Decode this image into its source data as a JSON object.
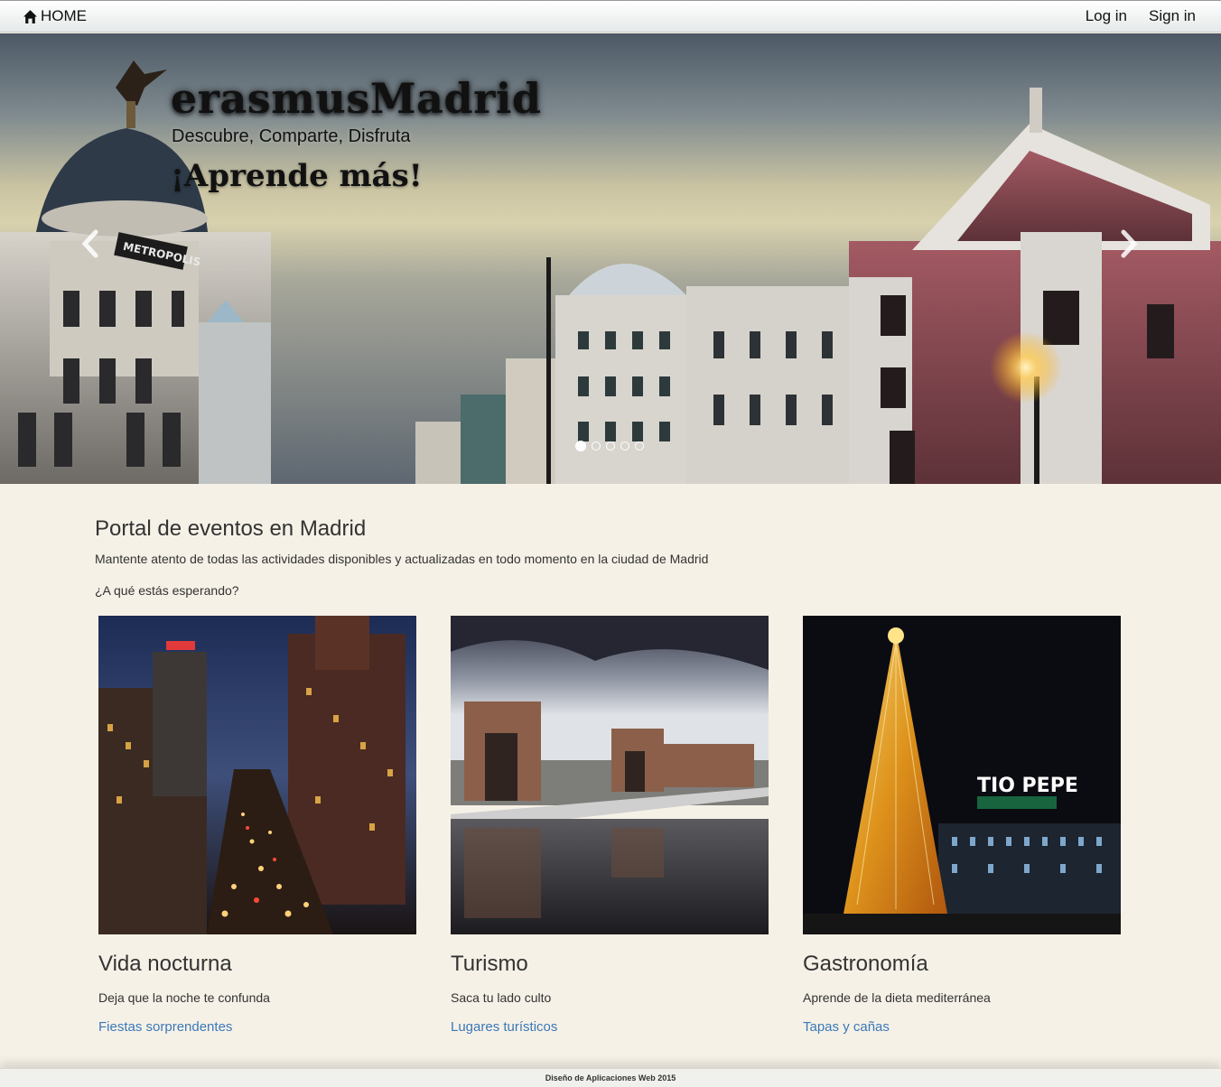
{
  "navbar": {
    "home_label": "HOME",
    "home_icon": "home-icon",
    "login_label": "Log in",
    "signin_label": "Sign in"
  },
  "hero": {
    "title": "erasmusMadrid",
    "subtitle": "Descubre, Comparte, Disfruta",
    "cta": "¡Aprende más!",
    "prev_icon": "chevron-left-icon",
    "next_icon": "chevron-right-icon",
    "slides_count": 5,
    "active_slide": 1,
    "sign_text": "METROPOLIS"
  },
  "intro": {
    "title": "Portal de eventos en Madrid",
    "text": "Mantente atento de todas las actividades disponibles y actualizadas en todo momento en la ciudad de Madrid",
    "question": "¿A qué estás esperando?"
  },
  "cards": [
    {
      "title": "Vida nocturna",
      "text": "Deja que la noche te confunda",
      "link": "Fiestas sorprendentes"
    },
    {
      "title": "Turismo",
      "text": "Saca tu lado culto",
      "link": "Lugares turísticos"
    },
    {
      "title": "Gastronomía",
      "text": "Aprende de la dieta mediterránea",
      "link": "Tapas y cañas",
      "image_sign": "TIO PEPE"
    }
  ],
  "footer": {
    "text": "Diseño de Aplicaciones Web 2015"
  },
  "colors": {
    "page_bg": "#f6f1e7",
    "link": "#3a79b9",
    "text": "#333333"
  }
}
